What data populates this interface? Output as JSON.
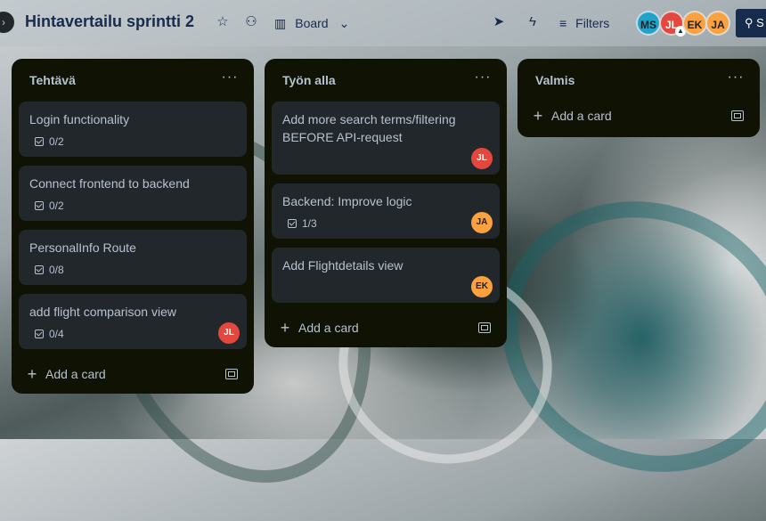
{
  "header": {
    "board_title": "Hintavertailu sprintti 2",
    "view_label": "Board",
    "filters_label": "Filters",
    "share_label": "S",
    "icons": [
      "star-icon",
      "workspace-visibility-icon",
      "board-view-icon",
      "chevron-down-icon",
      "power-ups-icon",
      "automation-icon",
      "filter-icon",
      "add-member-icon"
    ]
  },
  "members": [
    {
      "initials": "MS",
      "color": "#1fa3c9"
    },
    {
      "initials": "JL",
      "color": "#e2483d"
    },
    {
      "initials": "EK",
      "color": "#fca13f"
    },
    {
      "initials": "JA",
      "color": "#fca13f"
    }
  ],
  "lists": [
    {
      "title": "Tehtävä",
      "add_label": "Add a card",
      "cards": [
        {
          "title": "Login functionality",
          "checklist": "0/2",
          "member": ""
        },
        {
          "title": "Connect frontend to backend",
          "checklist": "0/2",
          "member": ""
        },
        {
          "title": "PersonalInfo Route",
          "checklist": "0/8",
          "member": ""
        },
        {
          "title": "add flight comparison view",
          "checklist": "0/4",
          "member": "JL"
        }
      ]
    },
    {
      "title": "Työn alla",
      "add_label": "Add a card",
      "cards": [
        {
          "title": "Add more search terms/filtering BEFORE API-request",
          "checklist": "",
          "member": "JL"
        },
        {
          "title": "Backend: Improve logic",
          "checklist": "1/3",
          "member": "JA"
        },
        {
          "title": "Add Flightdetails view",
          "checklist": "",
          "member": "EK"
        }
      ]
    },
    {
      "title": "Valmis",
      "add_label": "Add a card",
      "cards": []
    }
  ]
}
